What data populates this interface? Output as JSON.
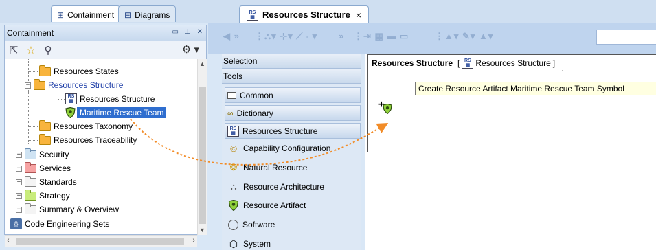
{
  "left_panel": {
    "tabs": [
      {
        "label": "Containment",
        "icon": "containment-tab-icon"
      },
      {
        "label": "Diagrams",
        "icon": "diagrams-tab-icon"
      }
    ],
    "header_title": "Containment",
    "header_buttons": [
      "restore",
      "pin",
      "close"
    ],
    "tree": [
      {
        "label": "Resources States",
        "icon": "folder-orange",
        "level": 2
      },
      {
        "label": "Resources Structure",
        "icon": "folder-orange",
        "level": 2,
        "expanded": true,
        "link_style": true
      },
      {
        "label": "Resources Structure",
        "icon": "diagram-icon",
        "level": 3
      },
      {
        "label": "Maritime Rescue Team",
        "icon": "resource-artifact-icon",
        "level": 3,
        "selected": true
      },
      {
        "label": "Resources Taxonomy",
        "icon": "folder-orange",
        "level": 2
      },
      {
        "label": "Resources Traceability",
        "icon": "folder-orange",
        "level": 2
      },
      {
        "label": "Security",
        "icon": "folder-blue",
        "level": 1
      },
      {
        "label": "Services",
        "icon": "folder-red",
        "level": 1
      },
      {
        "label": "Standards",
        "icon": "folder-white",
        "level": 1
      },
      {
        "label": "Strategy",
        "icon": "folder-green",
        "level": 1
      },
      {
        "label": "Summary & Overview",
        "icon": "folder-white",
        "level": 1
      },
      {
        "label": "Code Engineering Sets",
        "icon": "code-engineering-icon",
        "level": 0
      }
    ]
  },
  "editor": {
    "tab_title": "Resources Structure",
    "tab_close": "×",
    "palette": {
      "selection": "Selection",
      "tools": "Tools",
      "groups": [
        {
          "label": "Common",
          "icon": "common-folder-icon"
        },
        {
          "label": "Dictionary",
          "icon": "dictionary-icon"
        },
        {
          "label": "Resources Structure",
          "icon": "diagram-icon"
        }
      ],
      "items": [
        {
          "label": "Capability Configuration",
          "icon": "capability-configuration-icon"
        },
        {
          "label": "Natural Resource",
          "icon": "natural-resource-icon"
        },
        {
          "label": "Resource Architecture",
          "icon": "resource-architecture-icon"
        },
        {
          "label": "Resource Artifact",
          "icon": "resource-artifact-icon"
        },
        {
          "label": "Software",
          "icon": "software-icon"
        },
        {
          "label": "System",
          "icon": "system-icon"
        }
      ]
    },
    "diagram_frame": {
      "label_name": "Resources Structure",
      "bracket_open": "[",
      "label_diagram": "Resources Structure",
      "bracket_close": "]"
    },
    "tooltip": "Create Resource Artifact Maritime Rescue Team Symbol"
  },
  "colors": {
    "selection": "#2f6ecf",
    "panel_bg": "#d9e7f6",
    "drag_arrow": "#f28c28",
    "tooltip_bg": "#ffffe1"
  }
}
